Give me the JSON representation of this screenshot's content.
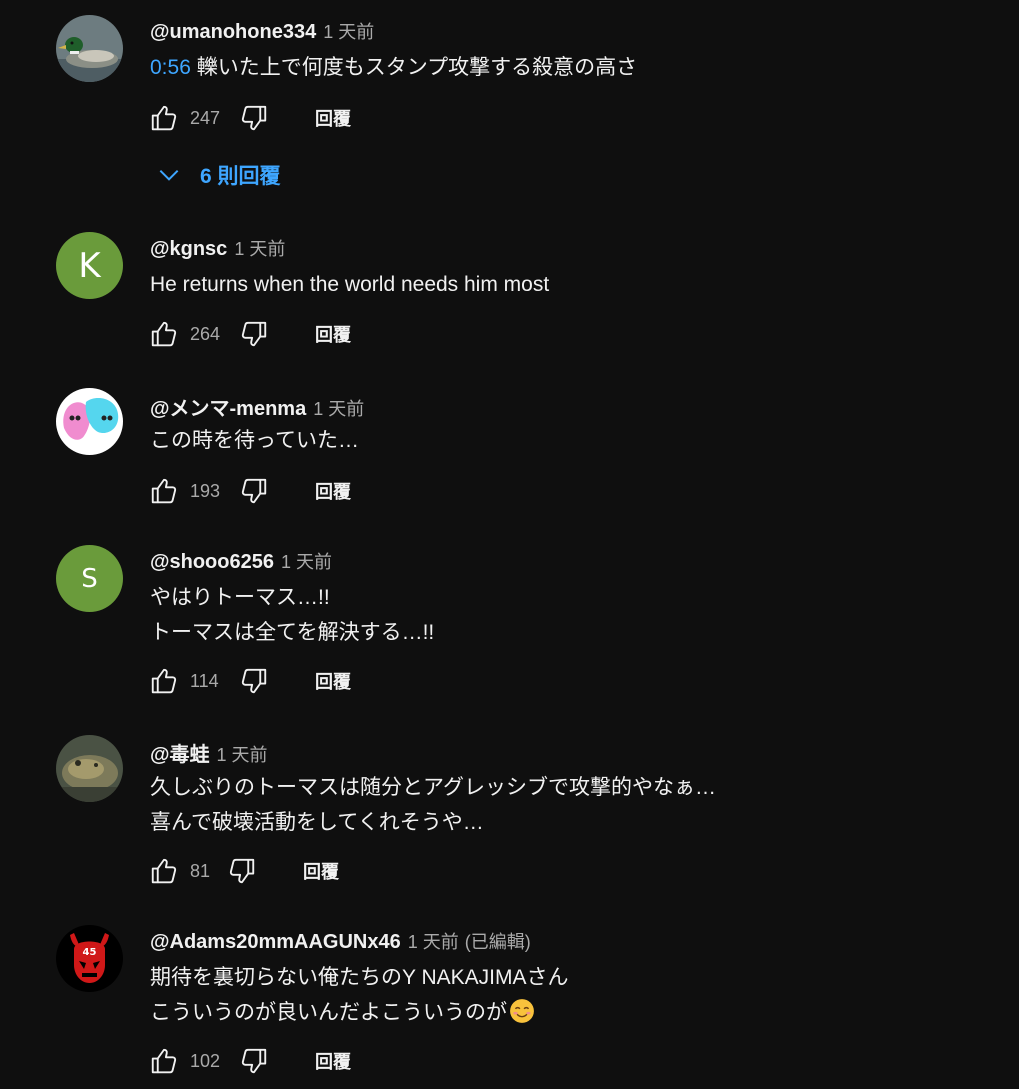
{
  "reply_label": "回覆",
  "colors": {
    "background": "#0f0f0f",
    "link": "#3ea6ff",
    "muted": "#aaaaaa",
    "avatar_green": "#6a9b3b"
  },
  "comments": [
    {
      "author": "@umanohone334",
      "time": "1 天前",
      "timestamp": "0:56",
      "line1": " 轢いた上で何度もスタンプ攻撃する殺意の高さ",
      "likes": "247",
      "avatar_icon": "duck-avatar-icon",
      "replies_label": "6 則回覆"
    },
    {
      "author": "@kgnsc",
      "time": "1 天前",
      "avatar_letter": "K",
      "line1": "He returns when the world needs him most",
      "likes": "264"
    },
    {
      "author": "@メンマ-menma",
      "time": "1 天前",
      "avatar_icon": "ghost-characters-avatar-icon",
      "line1": "この時を待っていた…",
      "likes": "193"
    },
    {
      "author": "@shooo6256",
      "time": "1 天前",
      "avatar_letter": "S",
      "line1": "やはりトーマス…!!",
      "line2": "トーマスは全てを解決する…!!",
      "likes": "114"
    },
    {
      "author": "@毒蛙",
      "time": "1 天前",
      "avatar_icon": "toad-avatar-icon",
      "line1": "久しぶりのトーマスは随分とアグレッシブで攻撃的やなぁ…",
      "line2": "喜んで破壊活動をしてくれそうや…",
      "likes": "81"
    },
    {
      "author": "@Adams20mmAAGUNx46",
      "time": "1 天前",
      "edited": "(已編輯)",
      "avatar_icon": "red-devil-skull-avatar-icon",
      "avatar_text": "45",
      "line1": "期待を裏切らない俺たちのY NAKAJIMAさん",
      "line2": "こういうのが良いんだよこういうのが",
      "emoji": "smiling-face-emoji",
      "likes": "102"
    }
  ]
}
